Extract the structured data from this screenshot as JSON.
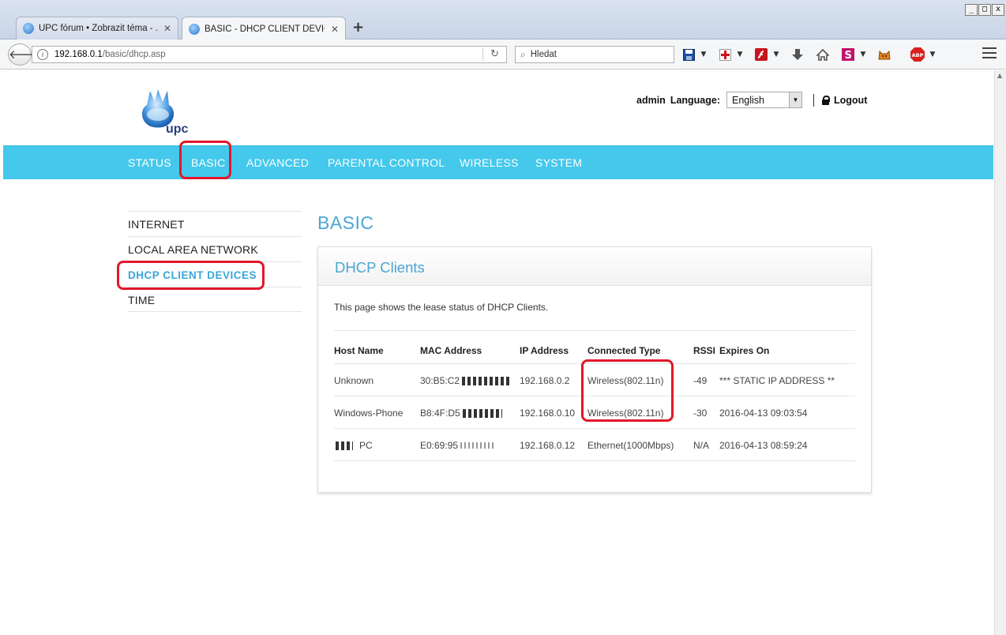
{
  "browser": {
    "tabs": [
      {
        "title": "UPC fórum • Zobrazit téma - ...",
        "active": false
      },
      {
        "title": "BASIC - DHCP CLIENT DEVICES",
        "active": true
      }
    ],
    "url": {
      "host": "192.168.0.1",
      "path": "/basic/dhcp.asp"
    },
    "search_placeholder": "Hledat",
    "window_buttons": [
      "_",
      "□",
      "x"
    ],
    "toolbar_icons": [
      "save-icon",
      "plus-cross-icon",
      "flash-icon",
      "download-icon",
      "home-icon",
      "s-extension-icon",
      "cat-icon",
      "adblock-icon",
      "menu-icon"
    ],
    "adblock_label": "ABP"
  },
  "header": {
    "logo_text": "upc",
    "user": "admin",
    "language_label": "Language:",
    "language_value": "English",
    "logout_label": "Logout"
  },
  "mainnav": {
    "items": [
      "STATUS",
      "BASIC",
      "ADVANCED",
      "PARENTAL CONTROL",
      "WIRELESS",
      "SYSTEM"
    ],
    "active": "BASIC"
  },
  "sidebar": {
    "items": [
      "INTERNET",
      "LOCAL AREA NETWORK",
      "DHCP CLIENT DEVICES",
      "TIME"
    ],
    "active": "DHCP CLIENT DEVICES"
  },
  "content": {
    "page_title": "BASIC",
    "panel_title": "DHCP Clients",
    "description": "This page shows the lease status of DHCP Clients.",
    "table": {
      "headers": [
        "Host Name",
        "MAC Address",
        "IP Address",
        "Connected Type",
        "RSSI",
        "Expires On"
      ],
      "rows": [
        {
          "host": "Unknown",
          "mac": "30:B5:C2",
          "ip": "192.168.0.2",
          "type": "Wireless(802.11n)",
          "rssi": "-49",
          "expires": "*** STATIC IP ADDRESS **"
        },
        {
          "host": "Windows-Phone",
          "mac": "B8:4F:D5",
          "ip": "192.168.0.10",
          "type": "Wireless(802.11n)",
          "rssi": "-30",
          "expires": "2016-04-13 09:03:54"
        },
        {
          "host": "PC",
          "mac": "E0:69:95",
          "ip": "192.168.0.12",
          "type": "Ethernet(1000Mbps)",
          "rssi": "N/A",
          "expires": "2016-04-13 08:59:24"
        }
      ]
    }
  },
  "colors": {
    "nav_bar": "#44c8eb",
    "accent": "#4ba5d4",
    "highlight": "#e0182a"
  }
}
